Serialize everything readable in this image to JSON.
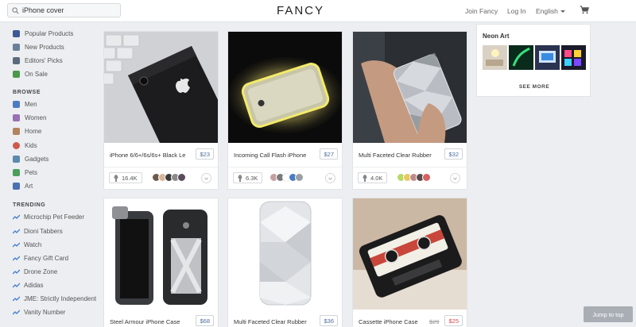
{
  "header": {
    "search_value": "iPhone cover",
    "logo": "FANCY",
    "join": "Join Fancy",
    "login": "Log In",
    "language": "English"
  },
  "sidebar": {
    "top_items": [
      {
        "label": "Popular Products",
        "icon": "facebook-icon",
        "color": "#3b5998"
      },
      {
        "label": "New Products",
        "icon": "plus-icon",
        "color": "#6a7f9a"
      },
      {
        "label": "Editors' Picks",
        "icon": "check-icon",
        "color": "#5a6b7d"
      },
      {
        "label": "On Sale",
        "icon": "tag-icon",
        "color": "#4a9a4a"
      }
    ],
    "browse_heading": "BROWSE",
    "browse_items": [
      {
        "label": "Men",
        "icon": "men-icon",
        "color": "#4a7cc2"
      },
      {
        "label": "Women",
        "icon": "women-icon",
        "color": "#9a6fb5"
      },
      {
        "label": "Home",
        "icon": "home-icon",
        "color": "#b5835a"
      },
      {
        "label": "Kids",
        "icon": "kids-icon",
        "color": "#d05a4a"
      },
      {
        "label": "Gadgets",
        "icon": "gadgets-icon",
        "color": "#5a8ab0"
      },
      {
        "label": "Pets",
        "icon": "pets-icon",
        "color": "#4aa05a"
      },
      {
        "label": "Art",
        "icon": "art-icon",
        "color": "#4a6fb5"
      }
    ],
    "trending_heading": "TRENDING",
    "trending_items": [
      "Microchip Pet Feeder",
      "Dioni Tabbers",
      "Watch",
      "Fancy Gift Card",
      "Drone Zone",
      "Adidas",
      "JME: Strictly Independent",
      "Vanity Number"
    ]
  },
  "products": [
    {
      "title": "iPhone 6/6+/6s/6s+ Black Le",
      "price": "$23",
      "fancy_count": "16.4K"
    },
    {
      "title": "Incoming Call Flash iPhone",
      "price": "$27",
      "fancy_count": "6.3K"
    },
    {
      "title": "Multi Faceted Clear Rubber",
      "price": "$32",
      "fancy_count": "4.0K"
    },
    {
      "title": "Steel Armour iPhone Case",
      "price": "$68"
    },
    {
      "title": "Multi Faceted Clear Rubber",
      "price": "$36"
    },
    {
      "title": "Cassette iPhone Case",
      "old_price": "$29",
      "price": "$25"
    }
  ],
  "neon_panel": {
    "title": "Neon Art",
    "see_more": "SEE MORE"
  },
  "jump_to_top": "Jump to top",
  "colors": {
    "price_blue": "#4a6fa0",
    "sale_red": "#d24b4b",
    "trend_blue": "#3a7bd5"
  }
}
